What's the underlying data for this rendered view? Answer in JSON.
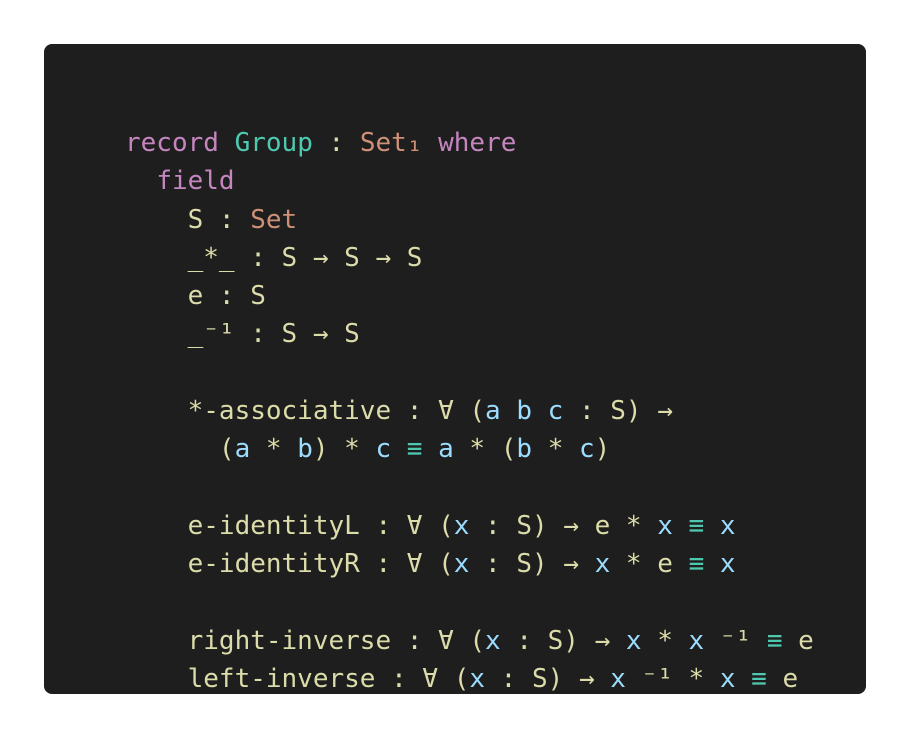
{
  "colors": {
    "background": "#ffffff",
    "panel": "#1e1e1e",
    "keyword": "#c586c0",
    "type_name": "#4ec9b0",
    "set": "#ce9178",
    "variable": "#9cdcfe",
    "equality": "#4ec9b0",
    "default": "#dcdcaa"
  },
  "code": {
    "lines": [
      [
        {
          "t": "record",
          "c": "kw"
        },
        {
          "t": " ",
          "c": "plain"
        },
        {
          "t": "Group",
          "c": "type"
        },
        {
          "t": " : ",
          "c": "plain"
        },
        {
          "t": "Set₁",
          "c": "set"
        },
        {
          "t": " ",
          "c": "plain"
        },
        {
          "t": "where",
          "c": "kw"
        }
      ],
      [
        {
          "t": "  ",
          "c": "plain"
        },
        {
          "t": "field",
          "c": "kw"
        }
      ],
      [
        {
          "t": "    S : ",
          "c": "plain"
        },
        {
          "t": "Set",
          "c": "set"
        }
      ],
      [
        {
          "t": "    _*_ : S → S → S",
          "c": "plain"
        }
      ],
      [
        {
          "t": "    e : S",
          "c": "plain"
        }
      ],
      [
        {
          "t": "    _⁻¹ : S → S",
          "c": "plain"
        }
      ],
      [],
      [
        {
          "t": "    *-associative : ∀ (",
          "c": "plain"
        },
        {
          "t": "a b c",
          "c": "var"
        },
        {
          "t": " : S) →",
          "c": "plain"
        }
      ],
      [
        {
          "t": "      (",
          "c": "plain"
        },
        {
          "t": "a",
          "c": "var"
        },
        {
          "t": " * ",
          "c": "plain"
        },
        {
          "t": "b",
          "c": "var"
        },
        {
          "t": ") * ",
          "c": "plain"
        },
        {
          "t": "c",
          "c": "var"
        },
        {
          "t": " ",
          "c": "plain"
        },
        {
          "t": "≡",
          "c": "eq"
        },
        {
          "t": " ",
          "c": "plain"
        },
        {
          "t": "a",
          "c": "var"
        },
        {
          "t": " * (",
          "c": "plain"
        },
        {
          "t": "b",
          "c": "var"
        },
        {
          "t": " * ",
          "c": "plain"
        },
        {
          "t": "c",
          "c": "var"
        },
        {
          "t": ")",
          "c": "plain"
        }
      ],
      [],
      [
        {
          "t": "    e-identityL : ∀ (",
          "c": "plain"
        },
        {
          "t": "x",
          "c": "var"
        },
        {
          "t": " : S) → e * ",
          "c": "plain"
        },
        {
          "t": "x",
          "c": "var"
        },
        {
          "t": " ",
          "c": "plain"
        },
        {
          "t": "≡",
          "c": "eq"
        },
        {
          "t": " ",
          "c": "plain"
        },
        {
          "t": "x",
          "c": "var"
        }
      ],
      [
        {
          "t": "    e-identityR : ∀ (",
          "c": "plain"
        },
        {
          "t": "x",
          "c": "var"
        },
        {
          "t": " : S) → ",
          "c": "plain"
        },
        {
          "t": "x",
          "c": "var"
        },
        {
          "t": " * e ",
          "c": "plain"
        },
        {
          "t": "≡",
          "c": "eq"
        },
        {
          "t": " ",
          "c": "plain"
        },
        {
          "t": "x",
          "c": "var"
        }
      ],
      [],
      [
        {
          "t": "    right-inverse : ∀ (",
          "c": "plain"
        },
        {
          "t": "x",
          "c": "var"
        },
        {
          "t": " : S) → ",
          "c": "plain"
        },
        {
          "t": "x",
          "c": "var"
        },
        {
          "t": " * ",
          "c": "plain"
        },
        {
          "t": "x",
          "c": "var"
        },
        {
          "t": " ⁻¹ ",
          "c": "plain"
        },
        {
          "t": "≡",
          "c": "eq"
        },
        {
          "t": " e",
          "c": "plain"
        }
      ],
      [
        {
          "t": "    left-inverse : ∀ (",
          "c": "plain"
        },
        {
          "t": "x",
          "c": "var"
        },
        {
          "t": " : S) → ",
          "c": "plain"
        },
        {
          "t": "x",
          "c": "var"
        },
        {
          "t": " ⁻¹ * ",
          "c": "plain"
        },
        {
          "t": "x",
          "c": "var"
        },
        {
          "t": " ",
          "c": "plain"
        },
        {
          "t": "≡",
          "c": "eq"
        },
        {
          "t": " e",
          "c": "plain"
        }
      ]
    ]
  }
}
